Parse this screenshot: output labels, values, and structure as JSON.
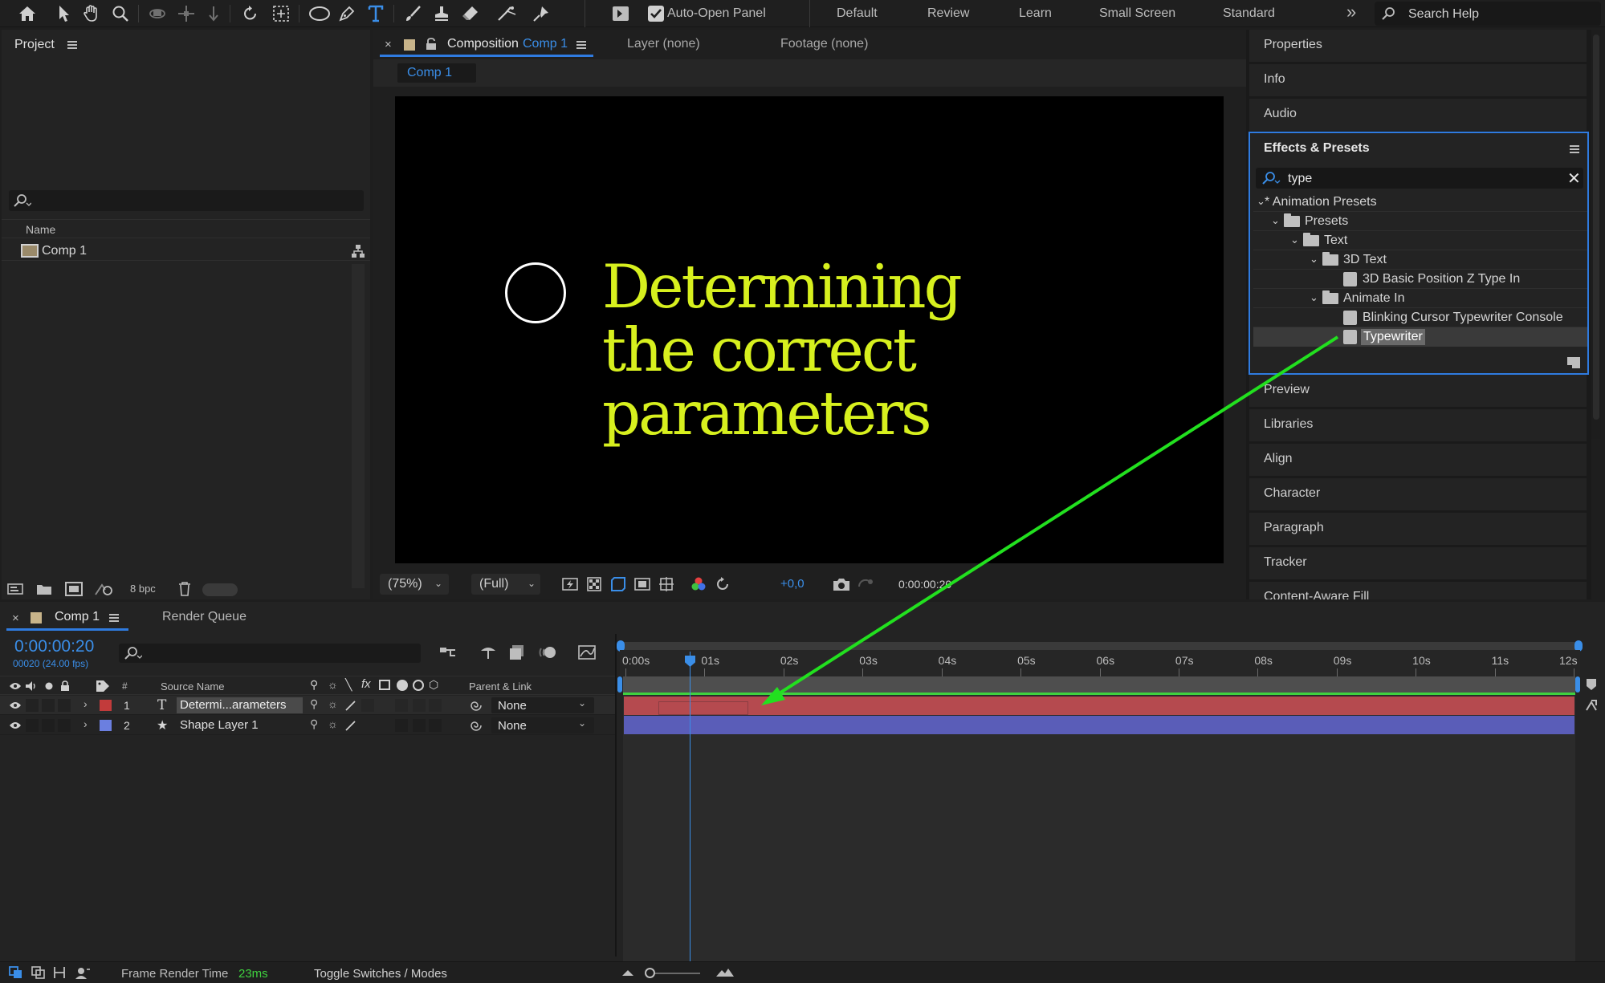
{
  "toolbar": {
    "auto_open_panel": "Auto-Open Panel",
    "workspaces": [
      "Default",
      "Review",
      "Learn",
      "Small Screen",
      "Standard"
    ],
    "overflow": "»",
    "search_help": "Search Help",
    "tools": [
      "home-icon",
      "selection-tool-icon",
      "hand-tool-icon",
      "zoom-tool-icon",
      "orbit-camera-icon",
      "pan-camera-icon",
      "dolly-camera-icon",
      "rotate-tool-icon",
      "pan-behind-icon",
      "ellipse-tool-icon",
      "pen-tool-icon",
      "type-tool-icon",
      "brush-tool-icon",
      "clone-stamp-icon",
      "eraser-icon",
      "roto-brush-icon",
      "puppet-pin-icon"
    ]
  },
  "project": {
    "title": "Project",
    "column_name": "Name",
    "items": [
      {
        "name": "Comp 1"
      }
    ],
    "bpc": "8 bpc"
  },
  "composition": {
    "close": "×",
    "title_prefix": "Composition",
    "title_name": "Comp 1",
    "layer_tab": "Layer (none)",
    "footage_tab": "Footage (none)",
    "sub_tab": "Comp 1",
    "text_lines": [
      "Determining",
      "the correct",
      "parameters"
    ],
    "text_color": "#d7f01e",
    "zoom": "(75%)",
    "resolution": "(Full)",
    "exposure": "+0,0",
    "timecode": "0:00:00:20"
  },
  "right_panels": {
    "top": [
      "Properties",
      "Info",
      "Audio"
    ],
    "bottom": [
      "Preview",
      "Libraries",
      "Align",
      "Character",
      "Paragraph",
      "Tracker",
      "Content-Aware Fill"
    ]
  },
  "effects": {
    "title": "Effects & Presets",
    "search": "type",
    "tree": [
      {
        "label": "* Animation Presets",
        "depth": 0,
        "kind": "folder-open-noicon"
      },
      {
        "label": "Presets",
        "depth": 1,
        "kind": "folder"
      },
      {
        "label": "Text",
        "depth": 2,
        "kind": "folder"
      },
      {
        "label": "3D Text",
        "depth": 3,
        "kind": "folder"
      },
      {
        "label": "3D Basic Position Z Type In",
        "depth": 4,
        "kind": "preset"
      },
      {
        "label": "Animate In",
        "depth": 3,
        "kind": "folder"
      },
      {
        "label": "Blinking Cursor Typewriter Console",
        "depth": 4,
        "kind": "preset"
      },
      {
        "label": "Typewriter",
        "depth": 4,
        "kind": "preset",
        "selected": true
      }
    ]
  },
  "timeline": {
    "comp_tab": "Comp 1",
    "render_queue": "Render Queue",
    "timecode": "0:00:00:20",
    "frame_info": "00020 (24.00 fps)",
    "col_num": "#",
    "col_source": "Source Name",
    "col_parent": "Parent & Link",
    "layers": [
      {
        "num": "1",
        "type": "T",
        "name": "Determi...arameters",
        "parent": "None",
        "label_color": "#c23b3b",
        "bar_color": "#b54a4f"
      },
      {
        "num": "2",
        "type": "★",
        "name": "Shape Layer 1",
        "parent": "None",
        "label_color": "#6b7fe0",
        "bar_color": "#5a5db8"
      }
    ],
    "ticks": [
      "0:00s",
      "01s",
      "02s",
      "03s",
      "04s",
      "05s",
      "06s",
      "07s",
      "08s",
      "09s",
      "10s",
      "11s",
      "12s"
    ],
    "frame_render_label": "Frame Render Time",
    "frame_render_value": "23ms",
    "toggle_label": "Toggle Switches / Modes"
  },
  "annotation_color": "#22e01f"
}
